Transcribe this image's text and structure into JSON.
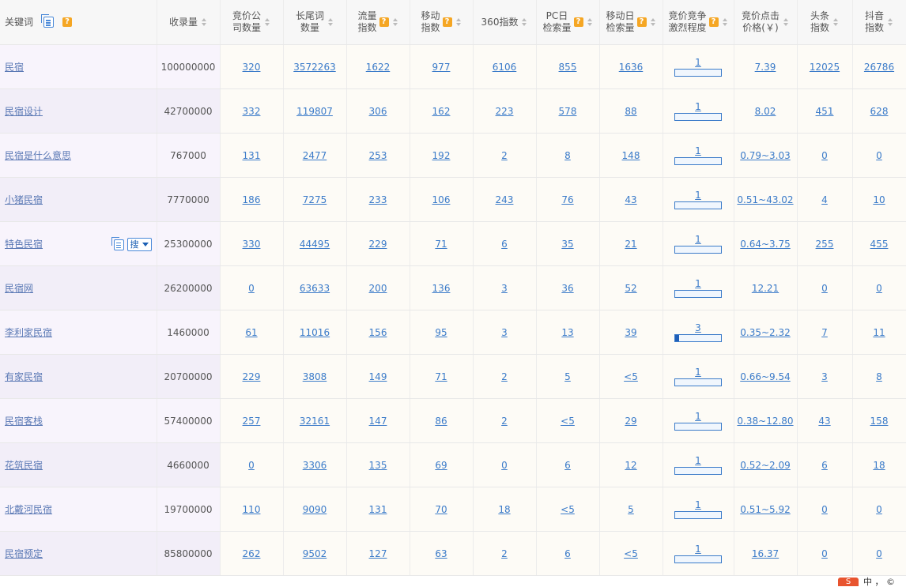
{
  "headers": {
    "keyword": "关键词",
    "shoulu": "收录量",
    "bid_company": [
      "竞价公",
      "司数量"
    ],
    "longtail": [
      "长尾词",
      "数量"
    ],
    "flow": [
      "流量",
      "指数"
    ],
    "mobile": [
      "移动",
      "指数"
    ],
    "i360": "360指数",
    "pc_daily": [
      "PC日",
      "检索量"
    ],
    "mobile_daily": [
      "移动日",
      "检索量"
    ],
    "competition": [
      "竞价竞争",
      "激烈程度"
    ],
    "cpc": [
      "竞价点击",
      "价格(￥)"
    ],
    "toutiao": [
      "头条",
      "指数"
    ],
    "douyin": [
      "抖音",
      "指数"
    ],
    "help_mark": "?"
  },
  "row_tools": {
    "search_label": "搜"
  },
  "rows": [
    {
      "keyword": "民宿",
      "shoulu": "100000000",
      "bid_company": "320",
      "longtail": "3572263",
      "flow": "1622",
      "mobile": "977",
      "i360": "6106",
      "pc_daily": "855",
      "mobile_daily": "1636",
      "competition": "1",
      "competition_level": 0,
      "cpc": "7.39",
      "toutiao": "12025",
      "douyin": "26786"
    },
    {
      "keyword": "民宿设计",
      "shoulu": "42700000",
      "bid_company": "332",
      "longtail": "119807",
      "flow": "306",
      "mobile": "162",
      "i360": "223",
      "pc_daily": "578",
      "mobile_daily": "88",
      "competition": "1",
      "competition_level": 0,
      "cpc": "8.02",
      "toutiao": "451",
      "douyin": "628"
    },
    {
      "keyword": "民宿是什么意思",
      "shoulu": "767000",
      "bid_company": "131",
      "longtail": "2477",
      "flow": "253",
      "mobile": "192",
      "i360": "2",
      "pc_daily": "8",
      "mobile_daily": "148",
      "competition": "1",
      "competition_level": 0,
      "cpc": "0.79~3.03",
      "toutiao": "0",
      "douyin": "0"
    },
    {
      "keyword": "小猪民宿",
      "shoulu": "7770000",
      "bid_company": "186",
      "longtail": "7275",
      "flow": "233",
      "mobile": "106",
      "i360": "243",
      "pc_daily": "76",
      "mobile_daily": "43",
      "competition": "1",
      "competition_level": 0,
      "cpc": "0.51~43.02",
      "toutiao": "4",
      "douyin": "10"
    },
    {
      "keyword": "特色民宿",
      "shoulu": "25300000",
      "bid_company": "330",
      "longtail": "44495",
      "flow": "229",
      "mobile": "71",
      "i360": "6",
      "pc_daily": "35",
      "mobile_daily": "21",
      "competition": "1",
      "competition_level": 0,
      "cpc": "0.64~3.75",
      "toutiao": "255",
      "douyin": "455",
      "hover": true
    },
    {
      "keyword": "民宿网",
      "shoulu": "26200000",
      "bid_company": "0",
      "longtail": "63633",
      "flow": "200",
      "mobile": "136",
      "i360": "3",
      "pc_daily": "36",
      "mobile_daily": "52",
      "competition": "1",
      "competition_level": 0,
      "cpc": "12.21",
      "toutiao": "0",
      "douyin": "0"
    },
    {
      "keyword": "李利家民宿",
      "shoulu": "1460000",
      "bid_company": "61",
      "longtail": "11016",
      "flow": "156",
      "mobile": "95",
      "i360": "3",
      "pc_daily": "13",
      "mobile_daily": "39",
      "competition": "3",
      "competition_level": 0.08,
      "cpc": "0.35~2.32",
      "toutiao": "7",
      "douyin": "11"
    },
    {
      "keyword": "有家民宿",
      "shoulu": "20700000",
      "bid_company": "229",
      "longtail": "3808",
      "flow": "149",
      "mobile": "71",
      "i360": "2",
      "pc_daily": "5",
      "mobile_daily": "<5",
      "competition": "1",
      "competition_level": 0,
      "cpc": "0.66~9.54",
      "toutiao": "3",
      "douyin": "8"
    },
    {
      "keyword": "民宿客栈",
      "shoulu": "57400000",
      "bid_company": "257",
      "longtail": "32161",
      "flow": "147",
      "mobile": "86",
      "i360": "2",
      "pc_daily": "<5",
      "mobile_daily": "29",
      "competition": "1",
      "competition_level": 0,
      "cpc": "0.38~12.80",
      "toutiao": "43",
      "douyin": "158"
    },
    {
      "keyword": "花筑民宿",
      "shoulu": "4660000",
      "bid_company": "0",
      "longtail": "3306",
      "flow": "135",
      "mobile": "69",
      "i360": "0",
      "pc_daily": "6",
      "mobile_daily": "12",
      "competition": "1",
      "competition_level": 0,
      "cpc": "0.52~2.09",
      "toutiao": "6",
      "douyin": "18"
    },
    {
      "keyword": "北戴河民宿",
      "shoulu": "19700000",
      "bid_company": "110",
      "longtail": "9090",
      "flow": "131",
      "mobile": "70",
      "i360": "18",
      "pc_daily": "<5",
      "mobile_daily": "5",
      "competition": "1",
      "competition_level": 0,
      "cpc": "0.51~5.92",
      "toutiao": "0",
      "douyin": "0"
    },
    {
      "keyword": "民宿预定",
      "shoulu": "85800000",
      "bid_company": "262",
      "longtail": "9502",
      "flow": "127",
      "mobile": "63",
      "i360": "2",
      "pc_daily": "6",
      "mobile_daily": "<5",
      "competition": "1",
      "competition_level": 0,
      "cpc": "16.37",
      "toutiao": "0",
      "douyin": "0"
    }
  ],
  "footer_badge": {
    "icon": "S",
    "text": "中 ， ©"
  }
}
